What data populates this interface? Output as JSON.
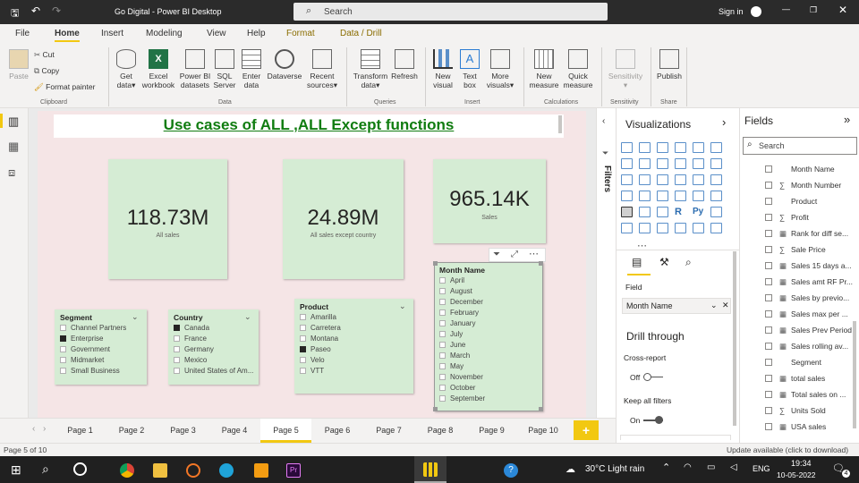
{
  "titlebar": {
    "title": "Go Digital - Power BI Desktop",
    "search": "Search",
    "signin": "Sign in"
  },
  "tabs": [
    "File",
    "Home",
    "Insert",
    "Modeling",
    "View",
    "Help",
    "Format",
    "Data / Drill"
  ],
  "ribbon": {
    "clipboard": {
      "paste": "Paste",
      "cut": "Cut",
      "copy": "Copy",
      "format_painter": "Format painter",
      "group": "Clipboard"
    },
    "data": {
      "get": "Get",
      "get2": "data",
      "excel": "Excel",
      "excel2": "workbook",
      "pbi": "Power BI",
      "pbi2": "datasets",
      "sql": "SQL",
      "sql2": "Server",
      "enter": "Enter",
      "enter2": "data",
      "dataverse": "Dataverse",
      "recent": "Recent",
      "recent2": "sources",
      "group": "Data"
    },
    "queries": {
      "transform": "Transform",
      "transform2": "data",
      "refresh": "Refresh",
      "group": "Queries"
    },
    "insert": {
      "newvis": "New",
      "newvis2": "visual",
      "textbox": "Text",
      "textbox2": "box",
      "more": "More",
      "more2": "visuals",
      "group": "Insert"
    },
    "calc": {
      "newm": "New",
      "newm2": "measure",
      "quick": "Quick",
      "quick2": "measure",
      "group": "Calculations"
    },
    "sens": {
      "label": "Sensitivity",
      "group": "Sensitivity"
    },
    "share": {
      "publish": "Publish",
      "group": "Share"
    }
  },
  "report": {
    "title": "Use cases of ALL ,ALL Except functions",
    "kpis": [
      {
        "value": "118.73M",
        "label": "All sales"
      },
      {
        "value": "24.89M",
        "label": "All sales except country"
      },
      {
        "value": "965.14K",
        "label": "Sales"
      }
    ],
    "segment": {
      "header": "Segment",
      "items": [
        "Channel Partners",
        "Enterprise",
        "Government",
        "Midmarket",
        "Small Business"
      ]
    },
    "country": {
      "header": "Country",
      "items": [
        "Canada",
        "France",
        "Germany",
        "Mexico",
        "United States of Am..."
      ]
    },
    "product": {
      "header": "Product",
      "items": [
        "Amarilla",
        "Carretera",
        "Montana",
        "Paseo",
        "Velo",
        "VTT"
      ]
    },
    "month": {
      "header": "Month Name",
      "items": [
        "April",
        "August",
        "December",
        "February",
        "January",
        "July",
        "June",
        "March",
        "May",
        "November",
        "October",
        "September"
      ]
    }
  },
  "filters_label": "Filters",
  "viz": {
    "title": "Visualizations",
    "field_label": "Field",
    "field_value": "Month Name",
    "drill": "Drill through",
    "cross": "Cross-report",
    "off": "Off",
    "keep": "Keep all filters",
    "on": "On"
  },
  "fields": {
    "title": "Fields",
    "search": "Search",
    "items": [
      "Month Name",
      "Month Number",
      "Product",
      "Profit",
      "Rank for diff se...",
      "Sale Price",
      "Sales 15 days a...",
      "Sales amt RF Pr...",
      "Sales by previo...",
      "Sales max per ...",
      "Sales Prev Period",
      "Sales rolling av...",
      "Segment",
      "total sales",
      "Total sales on ...",
      "Units Sold",
      "USA sales"
    ]
  },
  "pages": [
    "Page 1",
    "Page 2",
    "Page 3",
    "Page 4",
    "Page 5",
    "Page 6",
    "Page 7",
    "Page 8",
    "Page 9",
    "Page 10"
  ],
  "status": {
    "left": "Page 5 of 10",
    "right": "Update available (click to download)"
  },
  "taskbar": {
    "weather": "30°C  Light rain",
    "lang": "ENG",
    "time": "19:34",
    "date": "10-05-2022",
    "notif": "4"
  }
}
